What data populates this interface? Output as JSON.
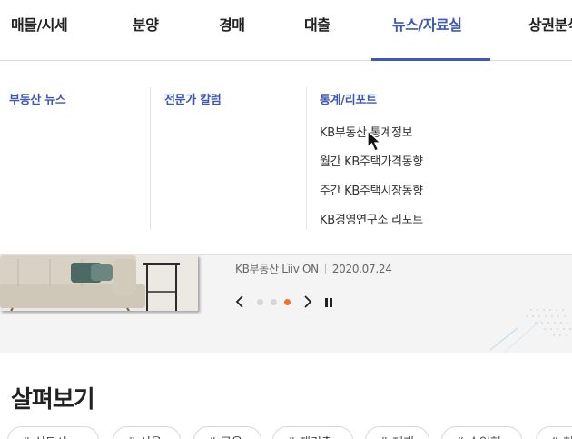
{
  "nav": {
    "items": [
      {
        "label": "매물/시세"
      },
      {
        "label": "분양"
      },
      {
        "label": "경매"
      },
      {
        "label": "대출"
      },
      {
        "label": "뉴스/자료실"
      },
      {
        "label": "상권분석"
      }
    ],
    "active_index": 4
  },
  "dropdown": {
    "columns": [
      {
        "title": "부동산 뉴스"
      },
      {
        "title": "전문가 칼럼"
      },
      {
        "title": "통계/리포트"
      }
    ],
    "stats_items": [
      {
        "label": "KB부동산 통계정보"
      },
      {
        "label": "월간 KB주택가격동향"
      },
      {
        "label": "주간 KB주택시장동향"
      },
      {
        "label": "KB경영연구소 리포트"
      }
    ]
  },
  "banner": {
    "source": "KB부동산 Liiv ON",
    "date": "2020.07.24",
    "slide_count": 3,
    "active_slide": 3,
    "prev_symbol": "‹",
    "next_symbol": "›"
  },
  "explore": {
    "title": "살펴보기",
    "chips": [
      "# 신도시",
      "# 서울",
      "# 금융",
      "# 재건축",
      "# 재개",
      "# 수익형",
      "# 청약"
    ]
  },
  "colors": {
    "accent": "#3e58b5",
    "slider_active": "#f2722b",
    "slider_inactive": "#d6d6d6"
  }
}
